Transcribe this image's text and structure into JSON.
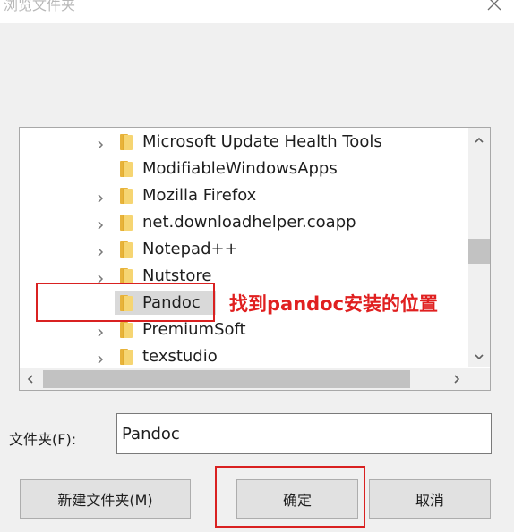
{
  "window": {
    "title": "浏览文件夹",
    "close_icon": "close-icon"
  },
  "tree": {
    "items": [
      {
        "label": "Microsoft Update Health Tools",
        "has_children": true,
        "selected": false
      },
      {
        "label": "ModifiableWindowsApps",
        "has_children": false,
        "selected": false
      },
      {
        "label": "Mozilla Firefox",
        "has_children": true,
        "selected": false
      },
      {
        "label": "net.downloadhelper.coapp",
        "has_children": true,
        "selected": false
      },
      {
        "label": "Notepad++",
        "has_children": true,
        "selected": false
      },
      {
        "label": "Nutstore",
        "has_children": true,
        "selected": false
      },
      {
        "label": "Pandoc",
        "has_children": false,
        "selected": true
      },
      {
        "label": "PremiumSoft",
        "has_children": true,
        "selected": false
      },
      {
        "label": "texstudio",
        "has_children": true,
        "selected": false
      }
    ],
    "folder_color": "#f2c14a"
  },
  "annotation": {
    "text": "找到pandoc安装的位置",
    "color": "#e02020"
  },
  "folder_field": {
    "label": "文件夹(F):",
    "value": "Pandoc"
  },
  "buttons": {
    "new_folder": "新建文件夹(M)",
    "ok": "确定",
    "cancel": "取消"
  }
}
